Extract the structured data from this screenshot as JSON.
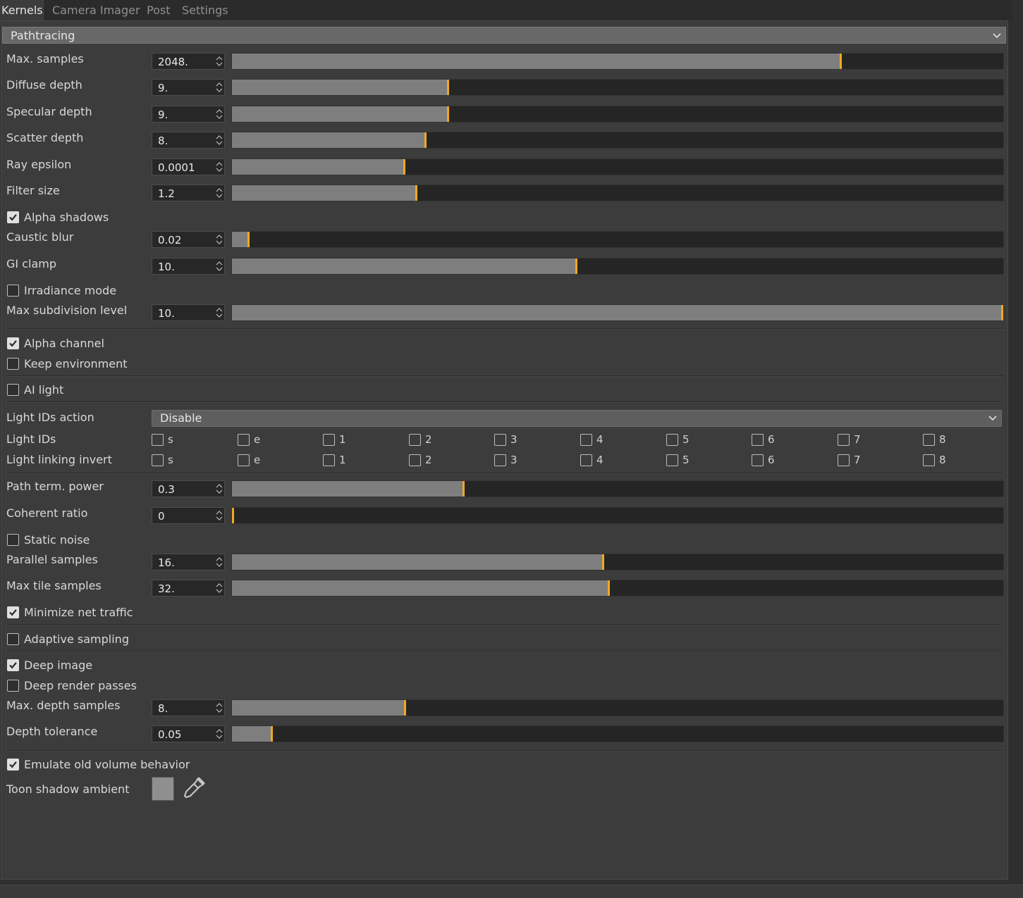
{
  "tabs": [
    "Kernels",
    "Camera Imager",
    "Post",
    "Settings"
  ],
  "section": {
    "title": "Pathtracing"
  },
  "sliders": [
    {
      "label": "Max. samples",
      "value": "2048.",
      "fraction": 0.79
    },
    {
      "label": "Diffuse depth",
      "value": "9.",
      "fraction": 0.28
    },
    {
      "label": "Specular depth",
      "value": "9.",
      "fraction": 0.28
    },
    {
      "label": "Scatter depth",
      "value": "8.",
      "fraction": 0.25
    },
    {
      "label": "Ray epsilon",
      "value": "0.0001",
      "fraction": 0.223
    },
    {
      "label": "Filter size",
      "value": "1.2",
      "fraction": 0.238
    },
    {
      "label": "Caustic blur",
      "value": "0.02",
      "fraction": 0.02
    },
    {
      "label": "GI clamp",
      "value": "10.",
      "fraction": 0.446
    },
    {
      "label": "Max subdivision level",
      "value": "10.",
      "fraction": 1.0
    },
    {
      "label": "Path term. power",
      "value": "0.3",
      "fraction": 0.3
    },
    {
      "label": "Coherent ratio",
      "value": "0",
      "fraction": 0.0
    },
    {
      "label": "Parallel samples",
      "value": "16.",
      "fraction": 0.481
    },
    {
      "label": "Max tile samples",
      "value": "32.",
      "fraction": 0.489
    },
    {
      "label": "Max. depth samples",
      "value": "8.",
      "fraction": 0.224
    },
    {
      "label": "Depth tolerance",
      "value": "0.05",
      "fraction": 0.05
    }
  ],
  "checkboxes": [
    {
      "label": "Alpha shadows",
      "checked": true
    },
    {
      "label": "Irradiance mode",
      "checked": false
    },
    {
      "label": "Alpha channel",
      "checked": true
    },
    {
      "label": "Keep environment",
      "checked": false
    },
    {
      "label": "AI light",
      "checked": false
    },
    {
      "label": "Static noise",
      "checked": false
    },
    {
      "label": "Minimize net traffic",
      "checked": true
    },
    {
      "label": "Adaptive sampling",
      "checked": false
    },
    {
      "label": "Deep image",
      "checked": true
    },
    {
      "label": "Deep render passes",
      "checked": false
    },
    {
      "label": "Emulate old volume behavior",
      "checked": true
    }
  ],
  "light_ids_action": {
    "label": "Light IDs action",
    "value": "Disable"
  },
  "light_ids": {
    "label": "Light IDs",
    "options": [
      "s",
      "e",
      "1",
      "2",
      "3",
      "4",
      "5",
      "6",
      "7",
      "8"
    ]
  },
  "light_linking_invert": {
    "label": "Light linking invert",
    "options": [
      "s",
      "e",
      "1",
      "2",
      "3",
      "4",
      "5",
      "6",
      "7",
      "8"
    ]
  },
  "toon_shadow_ambient": {
    "label": "Toon shadow ambient",
    "color": "#8f8f8f"
  },
  "colors": {
    "accent": "#f0a824",
    "fill": "#7e7e7e",
    "track": "#252525",
    "panel": "#3c3c3c"
  }
}
